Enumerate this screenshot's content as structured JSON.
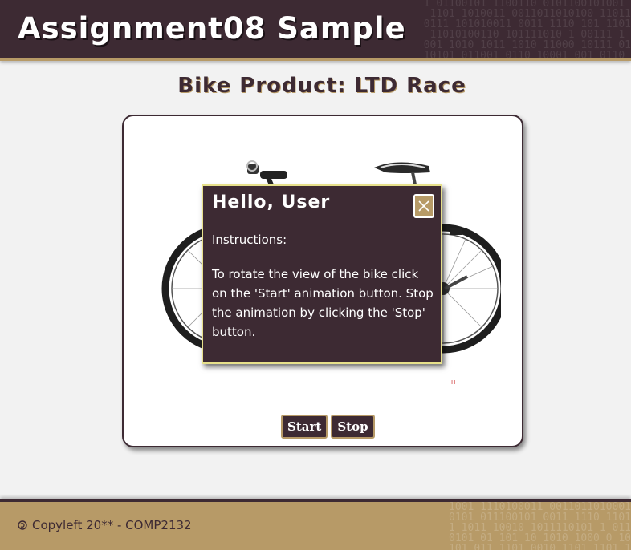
{
  "header": {
    "title": "Assignment08 Sample",
    "binary_pattern": "1 01100101 1100110 0101100101001\n 1101 1010011 0011011010100 11011\n0111 101010011 0011 1110 101 1101\n 11010100110 101111010 1 00111 1\n001 1010 1011 1010 11000 10111 01\n10101 011001 0110 10001 001 0110"
  },
  "page": {
    "heading": "Bike Product: LTD Race"
  },
  "product": {
    "image_name": "bike-image",
    "start_label": "Start",
    "stop_label": "Stop"
  },
  "dialog": {
    "title": "Hello, User",
    "close_icon": "close-icon",
    "label": "Instructions:",
    "body": "To rotate the view of the bike click on the 'Start' animation button. Stop the animation by clicking the 'Stop' button."
  },
  "footer": {
    "text": "Copyleft 20** - COMP2132",
    "icon": "copyleft-icon",
    "binary_pattern": "1001 1110100011 0011011010001\n0101 011100101 0011 1110 1101\n1 1011 10010 1011110101 1 011\n0101 01 101 10 1010 1000 0 10\n101 011 1101 0010 1101 1101 1"
  },
  "colors": {
    "primary": "#3d2a33",
    "accent": "#b79a67",
    "dialog_border": "#e6e08a",
    "background": "#f2f2f2"
  }
}
